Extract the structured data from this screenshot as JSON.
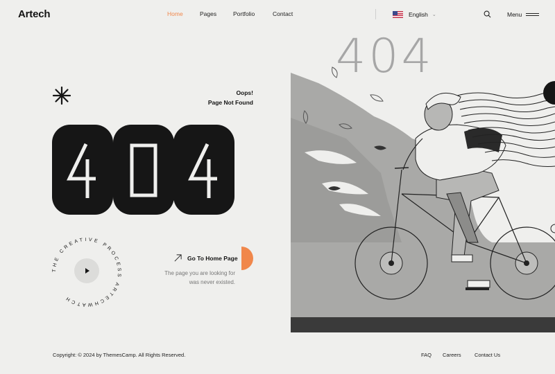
{
  "brand": {
    "logo": "Artech"
  },
  "nav": {
    "items": [
      {
        "label": "Home",
        "active": true
      },
      {
        "label": "Pages",
        "active": false
      },
      {
        "label": "Portfolio",
        "active": false
      },
      {
        "label": "Contact",
        "active": false
      }
    ]
  },
  "language": {
    "label": "English",
    "flag_icon": "us-flag-icon"
  },
  "menu": {
    "label": "Menu"
  },
  "error": {
    "title": "Oops!",
    "subtitle": "Page Not Found",
    "code": "404",
    "digits": [
      "4",
      "0",
      "4"
    ]
  },
  "badge": {
    "circular_text": "THE CREATIVE PROCESS ARTECHWATCH"
  },
  "cta": {
    "label": "Go To Home Page",
    "description": "The page you are looking for was never existed."
  },
  "illustration": {
    "heading": "404"
  },
  "footer": {
    "copyright": "Copyright: © 2024 by ThemesCamp. All Rights Reserved.",
    "links": [
      "FAQ",
      "Careers",
      "Contact Us"
    ]
  },
  "colors": {
    "accent": "#f0874b",
    "dark": "#161616",
    "background": "#efefed",
    "muted": "#777777"
  }
}
